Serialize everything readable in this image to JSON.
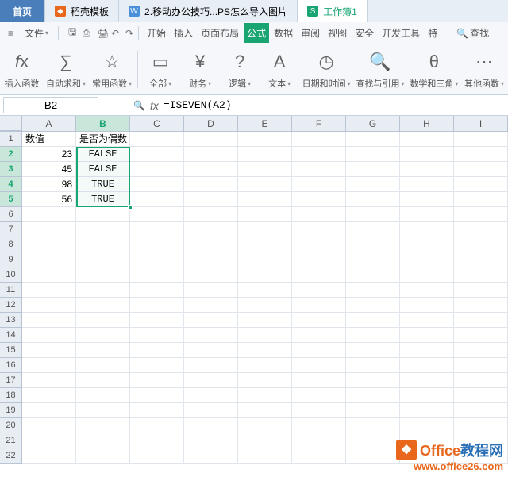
{
  "tabs": {
    "home": "首页",
    "template": "稻壳模板",
    "doc2": "2.移动办公技巧...PS怎么导入图片",
    "workbook": "工作簿1"
  },
  "menu": {
    "file": "文件",
    "items": [
      "开始",
      "插入",
      "页面布局",
      "公式",
      "数据",
      "审阅",
      "视图",
      "安全",
      "开发工具",
      "特"
    ],
    "search": "查找"
  },
  "ribbon": {
    "insert_fn": "插入函数",
    "autosum": "自动求和",
    "common": "常用函数",
    "all": "全部",
    "finance": "财务",
    "logic": "逻辑",
    "text": "文本",
    "datetime": "日期和时间",
    "lookup": "查找与引用",
    "math": "数学和三角",
    "other": "其他函数"
  },
  "namebox": "B2",
  "formula": "=ISEVEN(A2)",
  "columns": [
    "A",
    "B",
    "C",
    "D",
    "E",
    "F",
    "G",
    "H",
    "I"
  ],
  "rows": [
    "1",
    "2",
    "3",
    "4",
    "5",
    "6",
    "7",
    "8",
    "9",
    "10",
    "11",
    "12",
    "13",
    "14",
    "15",
    "16",
    "17",
    "18",
    "19",
    "20",
    "21",
    "22"
  ],
  "cells": {
    "a1": "数值",
    "b1": "是否为偶数",
    "a2": "23",
    "b2": "FALSE",
    "a3": "45",
    "b3": "FALSE",
    "a4": "98",
    "b4": "TRUE",
    "a5": "56",
    "b5": "TRUE"
  },
  "watermark": {
    "brand1a": "Office",
    "brand1b": "教程网",
    "url": "www.office26.com"
  }
}
